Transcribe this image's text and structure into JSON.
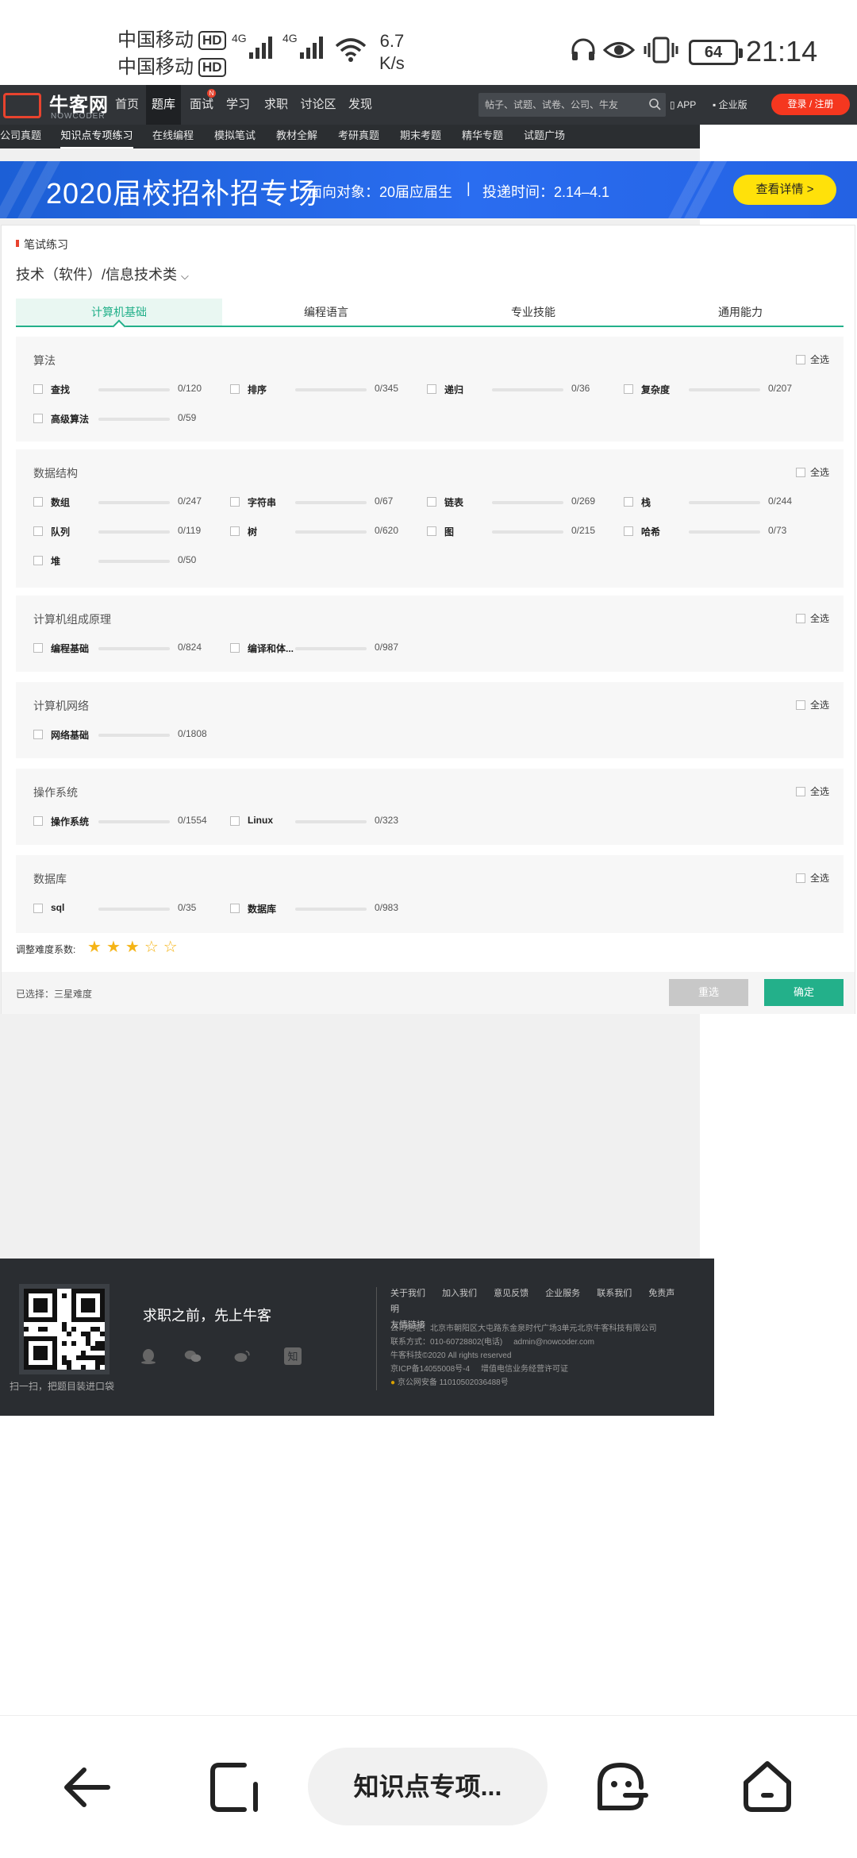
{
  "status_bar": {
    "carrier1": "中国移动",
    "carrier2": "中国移动",
    "hd": "HD",
    "net1": "4G",
    "net2": "4G",
    "speed_value": "6.7",
    "speed_unit": "K/s",
    "battery": "64",
    "time": "21:14"
  },
  "topnav": {
    "logo": "牛客网",
    "logo_sub": "NOWCODER",
    "items": [
      {
        "label": "首页"
      },
      {
        "label": "题库"
      },
      {
        "label": "面试",
        "badge": "N"
      },
      {
        "label": "学习"
      },
      {
        "label": "求职"
      },
      {
        "label": "讨论区"
      },
      {
        "label": "发现"
      }
    ],
    "search_placeholder": "帖子、试题、试卷、公司、牛友",
    "app": "APP",
    "enterprise": "企业版",
    "login": "登录 / 注册"
  },
  "subnav": {
    "items": [
      "公司真题",
      "知识点专项练习",
      "在线编程",
      "模拟笔试",
      "教材全解",
      "考研真题",
      "期末考题",
      "精华专题",
      "试题广场"
    ]
  },
  "banner": {
    "title": "2020届校招补招专场",
    "audience": "面向对象：20届应届生",
    "sep": "|",
    "deadline": "投递时间：2.14–4.1",
    "button": "查看详情 >"
  },
  "practice": {
    "label": "笔试练习",
    "category": "技术（软件）/信息技术类",
    "tabs": [
      "计算机基础",
      "编程语言",
      "专业技能",
      "通用能力"
    ],
    "select_all": "全选",
    "sections": [
      {
        "title": "算法",
        "items": [
          {
            "name": "查找",
            "count": "0/120"
          },
          {
            "name": "排序",
            "count": "0/345"
          },
          {
            "name": "递归",
            "count": "0/36"
          },
          {
            "name": "复杂度",
            "count": "0/207"
          },
          {
            "name": "高级算法",
            "count": "0/59"
          }
        ]
      },
      {
        "title": "数据结构",
        "items": [
          {
            "name": "数组",
            "count": "0/247"
          },
          {
            "name": "字符串",
            "count": "0/67"
          },
          {
            "name": "链表",
            "count": "0/269"
          },
          {
            "name": "栈",
            "count": "0/244"
          },
          {
            "name": "队列",
            "count": "0/119"
          },
          {
            "name": "树",
            "count": "0/620"
          },
          {
            "name": "图",
            "count": "0/215"
          },
          {
            "name": "哈希",
            "count": "0/73"
          },
          {
            "name": "堆",
            "count": "0/50"
          }
        ]
      },
      {
        "title": "计算机组成原理",
        "items": [
          {
            "name": "编程基础",
            "count": "0/824"
          },
          {
            "name": "编译和体...",
            "count": "0/987"
          }
        ]
      },
      {
        "title": "计算机网络",
        "items": [
          {
            "name": "网络基础",
            "count": "0/1808"
          }
        ]
      },
      {
        "title": "操作系统",
        "items": [
          {
            "name": "操作系统",
            "count": "0/1554"
          },
          {
            "name": "Linux",
            "count": "0/323"
          }
        ]
      },
      {
        "title": "数据库",
        "items": [
          {
            "name": "sql",
            "count": "0/35"
          },
          {
            "name": "数据库",
            "count": "0/983"
          }
        ]
      }
    ],
    "difficulty_label": "调整难度系数:",
    "difficulty_stars": 3,
    "difficulty_max": 5,
    "selected": "已选择：三星难度",
    "reset": "重选",
    "confirm": "确定"
  },
  "footer": {
    "scan_text": "扫一扫，把题目装进口袋",
    "slogan": "求职之前，先上牛客",
    "links": [
      "关于我们",
      "加入我们",
      "意见反馈",
      "企业服务",
      "联系我们",
      "免责声明",
      "友情链接"
    ],
    "address": "公司地址：北京市朝阳区大屯路东金泉时代广场3单元北京牛客科技有限公司",
    "contact": "联系方式：010-60728802(电话)",
    "email": "admin@nowcoder.com",
    "copyright": "牛客科技©2020 All rights reserved",
    "icp": "京ICP备14055008号-4",
    "license": "增值电信业务经营许可证",
    "police": "京公网安备 11010502036488号"
  },
  "android_nav": {
    "app_label": "知识点专项..."
  },
  "colors": {
    "accent": "#23b08a",
    "brand_red": "#e8432e",
    "nav_dark": "#313438",
    "banner_blue": "#2a6df0",
    "banner_button": "#ffe10a",
    "star": "#f5b416"
  }
}
